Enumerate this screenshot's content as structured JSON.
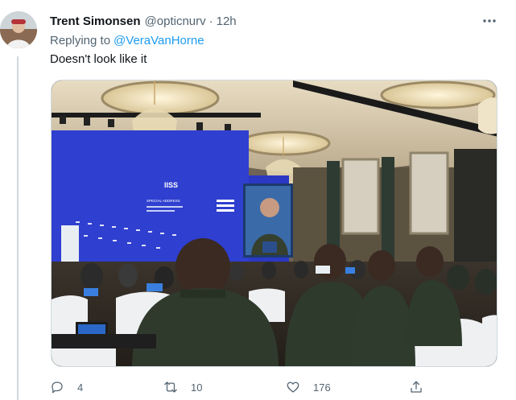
{
  "tweet": {
    "author_name": "Trent Simonsen",
    "handle": "@opticnurv",
    "separator": "·",
    "time": "12h",
    "replying_prefix": "Replying to",
    "replying_to": "@VeraVanHorne",
    "text": "Doesn't look like it",
    "more_icon": "more-icon"
  },
  "media": {
    "screen_logo": "IISS",
    "screen_subtitle": "SPECIAL ADDRESS"
  },
  "actions": {
    "reply_count": "4",
    "retweet_count": "10",
    "like_count": "176",
    "reply_icon": "reply-icon",
    "retweet_icon": "retweet-icon",
    "like_icon": "heart-icon",
    "share_icon": "share-icon"
  },
  "colors": {
    "link": "#1d9bf0",
    "secondary_text": "#536471",
    "primary_text": "#0f1419",
    "stage_blue": "#2f3fd0"
  }
}
